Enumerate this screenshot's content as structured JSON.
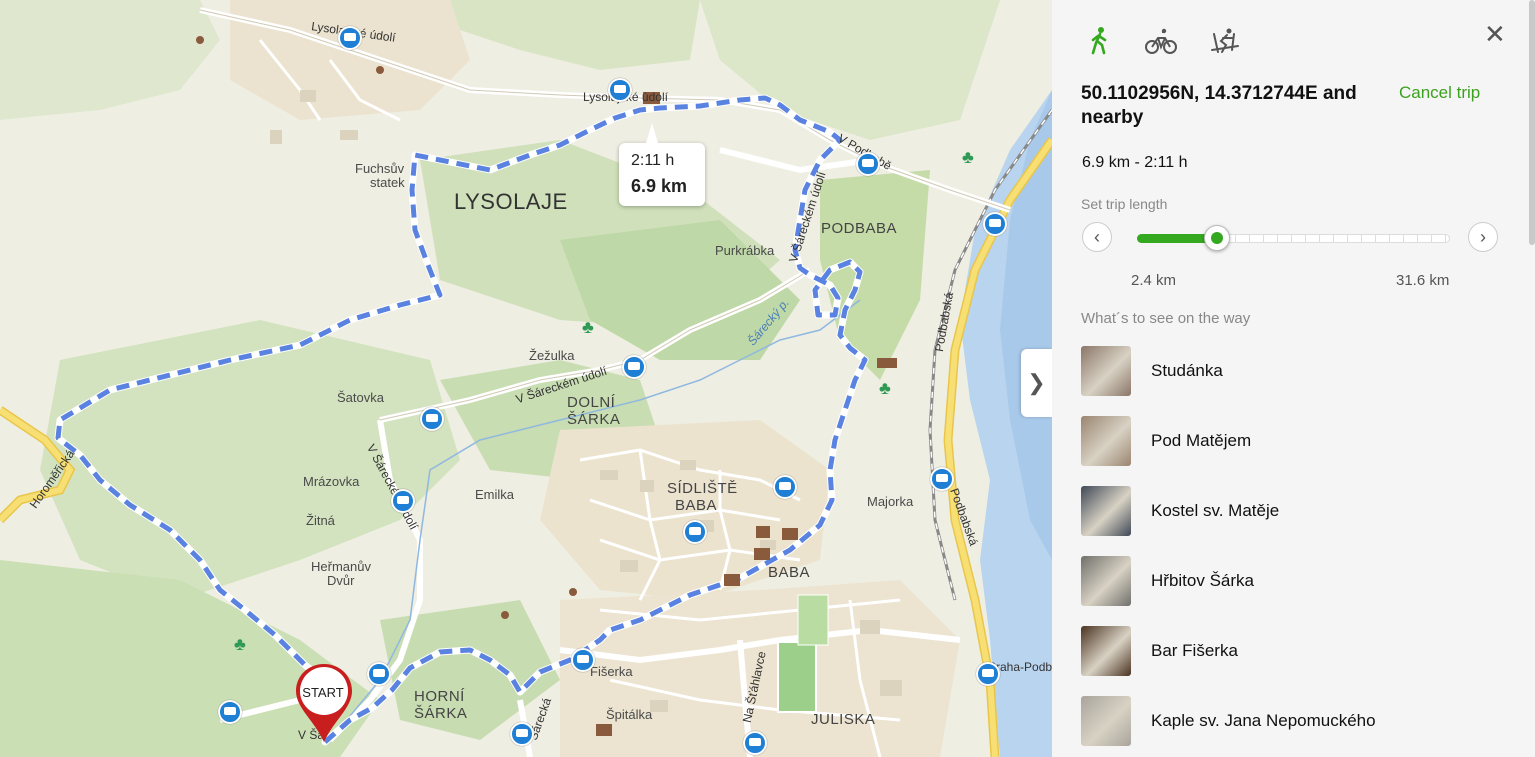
{
  "map": {
    "tooltip": {
      "time": "2:11 h",
      "distance": "6.9 km"
    },
    "start_label": "START",
    "place_labels": {
      "lysolaje": "LYSOLAJE",
      "podbaba": "PODBABA",
      "dolni_sarka_1": "DOLNÍ",
      "dolni_sarka_2": "ŠÁRKA",
      "sidliste_baba_1": "SÍDLIŠTĚ",
      "sidliste_baba_2": "BABA",
      "baba": "BABA",
      "horni_sarka_1": "HORNÍ",
      "horni_sarka_2": "ŠÁRKA",
      "juliska": "JULISKA"
    },
    "poi_labels": {
      "fuchsuv_1": "Fuchsův",
      "fuchsuv_2": "statek",
      "purkrabka": "Purkrábka",
      "zezulka": "Žežulka",
      "satovka": "Šatovka",
      "mrazovka": "Mrázovka",
      "emilka": "Emilka",
      "zitna": "Žitná",
      "hermanuv_1": "Heřmanův",
      "hermanuv_2": "Dvůr",
      "majorka": "Majorka",
      "fiserka": "Fišerka",
      "spitalka": "Špitálka"
    },
    "road_labels": {
      "lysolajske_1": "Lysolajské údolí",
      "lysolajske_2": "Lysolajské údolí",
      "v_sareckem": "V Šáreckém údolí",
      "v_sareckem_2": "V Šáreckém údolí",
      "v_sareckem_3": "V Šáreckém údolí",
      "saracky_potok": "Šárecký p.",
      "horomericka": "Horoměřická",
      "podbabska": "Podbabská",
      "podbabska_2": "Podbabská",
      "na_stahlavce": "Na Šťáhlavce",
      "sarecka": "Šárecká",
      "v_podbabe": "V Podbabě",
      "praha_podbaba": "Praha-Podbaba",
      "v_sar": "V Šá"
    },
    "toggle_icon": "chevron-right"
  },
  "panel": {
    "modes": [
      {
        "name": "walk",
        "icon": "walking-icon",
        "active": true
      },
      {
        "name": "bike",
        "icon": "bicycle-icon",
        "active": false
      },
      {
        "name": "ski",
        "icon": "ski-icon",
        "active": false
      }
    ],
    "close_icon": "close-icon",
    "title": "50.1102956N, 14.3712744E and nearby",
    "cancel_label": "Cancel trip",
    "summary": "6.9 km - 2:11 h",
    "set_length_label": "Set trip length",
    "slider": {
      "min_label": "2.4 km",
      "max_label": "31.6 km",
      "min_km": 2.4,
      "max_km": 31.6,
      "value_km": 6.9
    },
    "accent_color": "#34a81f",
    "whats_to_see_label": "What´s to see on the way",
    "places": [
      {
        "name": "Studánka",
        "thumb_color": "#8a7668"
      },
      {
        "name": "Pod Matějem",
        "thumb_color": "#9a8470"
      },
      {
        "name": "Kostel sv. Matěje",
        "thumb_color": "#3f4856"
      },
      {
        "name": "Hřbitov Šárka",
        "thumb_color": "#6f6f6a"
      },
      {
        "name": "Bar Fišerka",
        "thumb_color": "#4a3220"
      },
      {
        "name": "Kaple sv. Jana Nepomuckého",
        "thumb_color": "#a9a49c"
      }
    ]
  }
}
